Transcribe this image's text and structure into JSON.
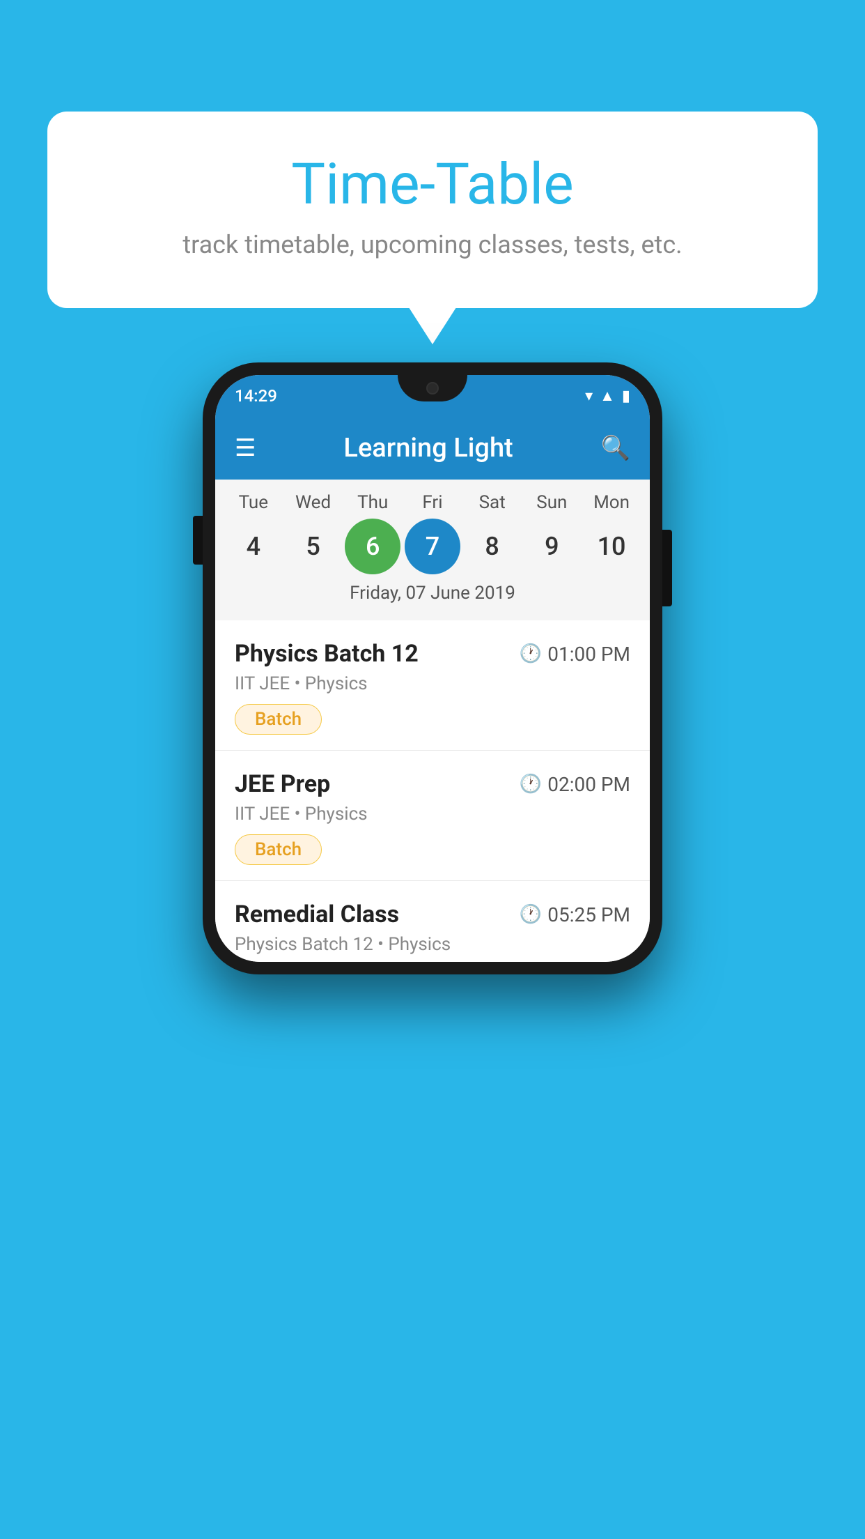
{
  "background": {
    "color": "#29b6e8"
  },
  "speech_bubble": {
    "title": "Time-Table",
    "subtitle": "track timetable, upcoming classes, tests, etc."
  },
  "phone": {
    "status_bar": {
      "time": "14:29"
    },
    "app_header": {
      "title": "Learning Light"
    },
    "calendar": {
      "days": [
        {
          "label": "Tue",
          "num": "4",
          "state": "normal"
        },
        {
          "label": "Wed",
          "num": "5",
          "state": "normal"
        },
        {
          "label": "Thu",
          "num": "6",
          "state": "today"
        },
        {
          "label": "Fri",
          "num": "7",
          "state": "selected"
        },
        {
          "label": "Sat",
          "num": "8",
          "state": "normal"
        },
        {
          "label": "Sun",
          "num": "9",
          "state": "normal"
        },
        {
          "label": "Mon",
          "num": "10",
          "state": "normal"
        }
      ],
      "selected_date": "Friday, 07 June 2019"
    },
    "classes": [
      {
        "name": "Physics Batch 12",
        "time": "01:00 PM",
        "meta": "IIT JEE • Physics",
        "tag": "Batch"
      },
      {
        "name": "JEE Prep",
        "time": "02:00 PM",
        "meta": "IIT JEE • Physics",
        "tag": "Batch"
      },
      {
        "name": "Remedial Class",
        "time": "05:25 PM",
        "meta": "Physics Batch 12 • Physics",
        "tag": null
      }
    ]
  }
}
